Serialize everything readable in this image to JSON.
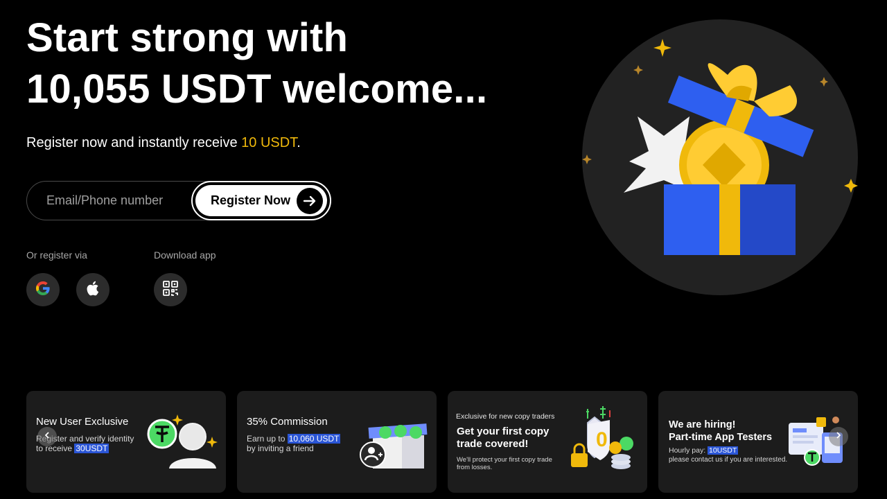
{
  "hero": {
    "title_line1": "Start strong with",
    "title_line2": "10,055 USDT welcome...",
    "subtitle_prefix": "Register now and instantly receive ",
    "subtitle_highlight": "10 USDT",
    "subtitle_suffix": "."
  },
  "register": {
    "placeholder": "Email/Phone number",
    "value": "",
    "button_label": "Register Now"
  },
  "social": {
    "label": "Or register via",
    "providers": [
      "google-icon",
      "apple-icon"
    ]
  },
  "download": {
    "label": "Download app",
    "icon": "qr-code-icon"
  },
  "cards": [
    {
      "title": "New User Exclusive",
      "line1": "Register and verify identity",
      "line2_prefix": "to receive ",
      "line2_tag": "30USDT"
    },
    {
      "title": "35% Commission",
      "line1_prefix": "Earn up to ",
      "line1_tag": "10,060 USDT",
      "line2": "by inviting a friend"
    },
    {
      "kicker": "Exclusive for new copy traders",
      "heading_line1": "Get your first copy",
      "heading_line2": "trade covered!",
      "small_line1": "We'll protect your first copy trade",
      "small_line2": "from losses."
    },
    {
      "heading_line1": "We are hiring!",
      "heading_line2": "Part-time App Testers",
      "pay_prefix": "Hourly pay: ",
      "pay_tag": "10USDT",
      "small_line": "please contact us if you are interested."
    }
  ],
  "colors": {
    "accent": "#f0b90b",
    "tag_blue": "#2a55d6",
    "card_bg": "#1c1c1c",
    "gift_blue": "#2e5ff0",
    "tether_green": "#4cd964"
  }
}
